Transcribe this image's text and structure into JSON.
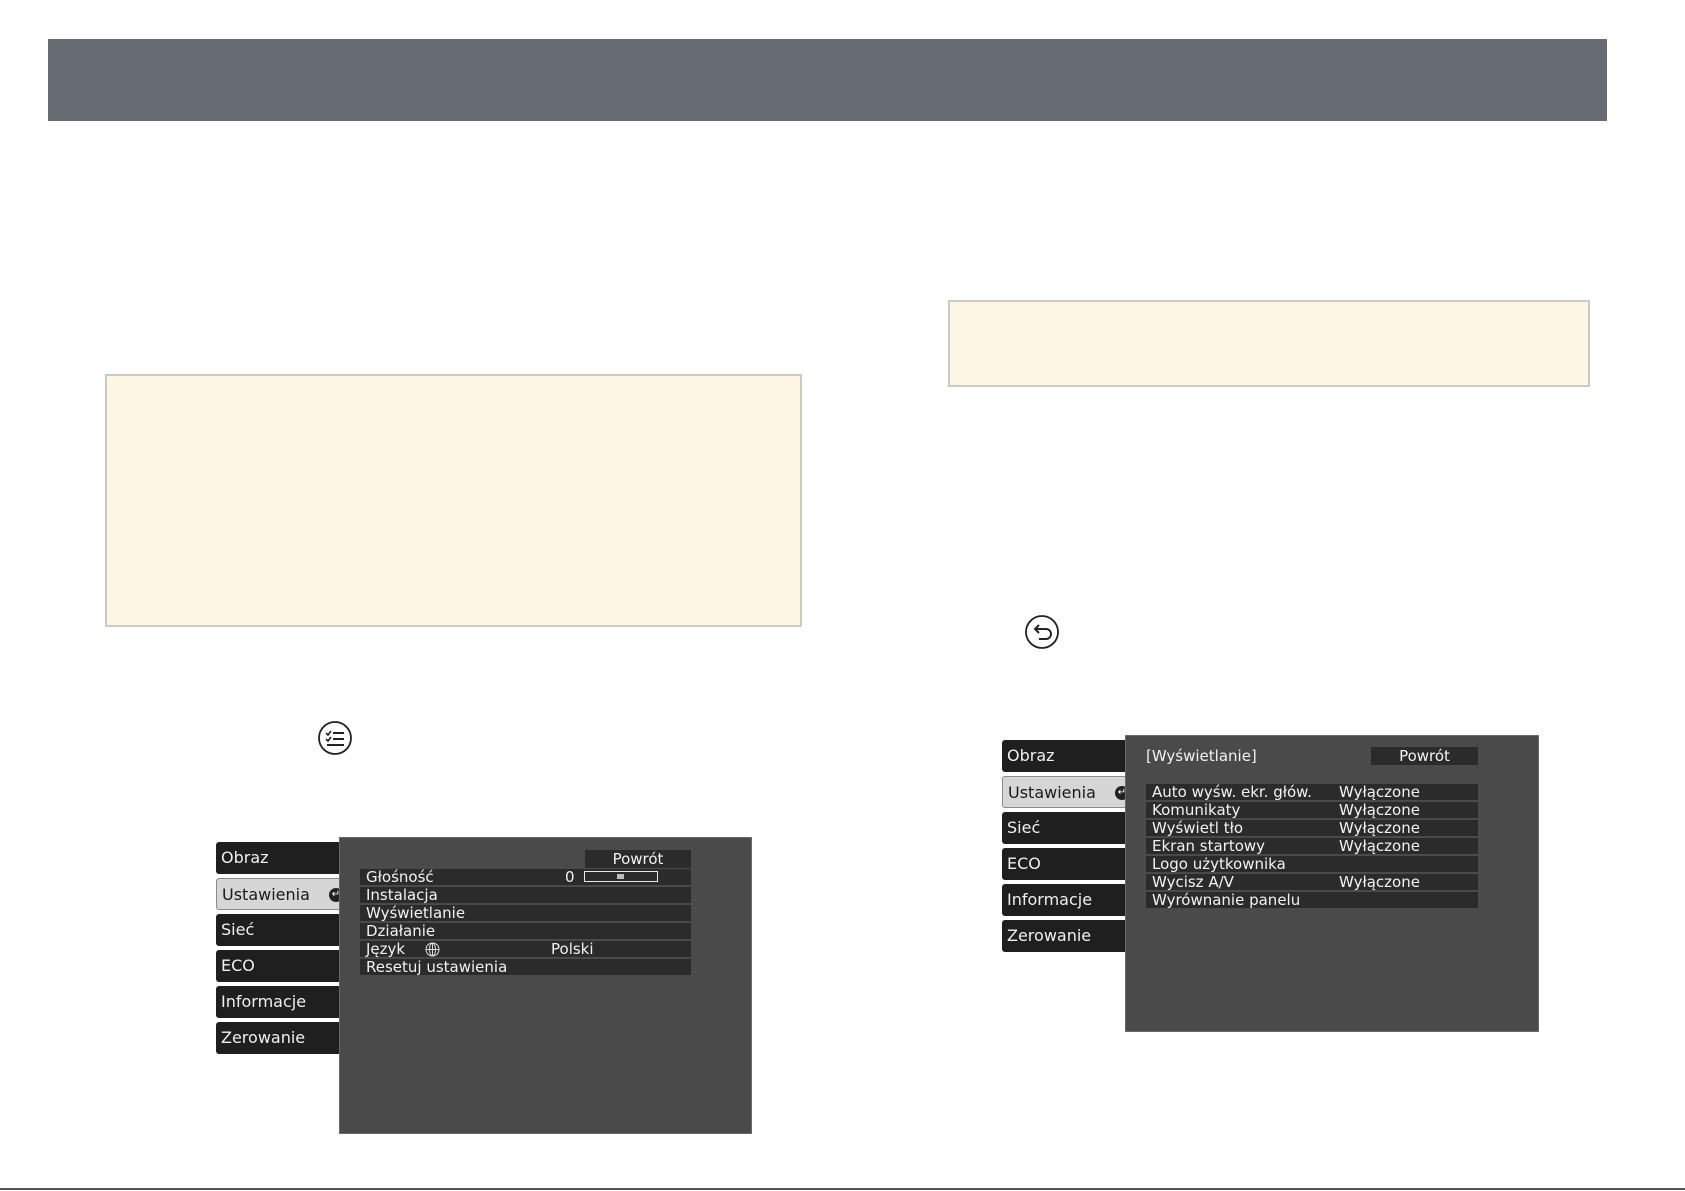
{
  "left_menu": {
    "sidebar": [
      "Obraz",
      "Ustawienia",
      "Sieć",
      "ECO",
      "Informacje",
      "Zerowanie"
    ],
    "active_index": 1,
    "back_label": "Powrót",
    "rows": [
      {
        "label": "Głośność",
        "value": "0"
      },
      {
        "label": "Instalacja",
        "value": ""
      },
      {
        "label": "Wyświetlanie",
        "value": ""
      },
      {
        "label": "Działanie",
        "value": ""
      },
      {
        "label": "Język",
        "value": "Polski"
      },
      {
        "label": "Resetuj ustawienia",
        "value": ""
      }
    ],
    "volume_level_fraction": 0.5
  },
  "right_menu": {
    "sidebar": [
      "Obraz",
      "Ustawienia",
      "Sieć",
      "ECO",
      "Informacje",
      "Zerowanie"
    ],
    "active_index": 1,
    "panel_title": "[Wyświetlanie]",
    "back_label": "Powrót",
    "rows": [
      {
        "label": "Auto wyśw. ekr. głów.",
        "value": "Wyłączone"
      },
      {
        "label": "Komunikaty",
        "value": "Wyłączone"
      },
      {
        "label": "Wyświetl tło",
        "value": "Wyłączone"
      },
      {
        "label": "Ekran startowy",
        "value": "Wyłączone"
      },
      {
        "label": "Logo użytkownika",
        "value": ""
      },
      {
        "label": "Wycisz A/V",
        "value": "Wyłączone"
      },
      {
        "label": "Wyrównanie panelu",
        "value": ""
      }
    ]
  },
  "icons": {
    "menu_button": "menu-list-icon",
    "esc_button": "return-arrow-icon",
    "language": "globe-icon"
  },
  "colors": {
    "header": "#676b73",
    "note_bg": "#fdf6e5",
    "menu_panel": "#4a4a4a"
  }
}
